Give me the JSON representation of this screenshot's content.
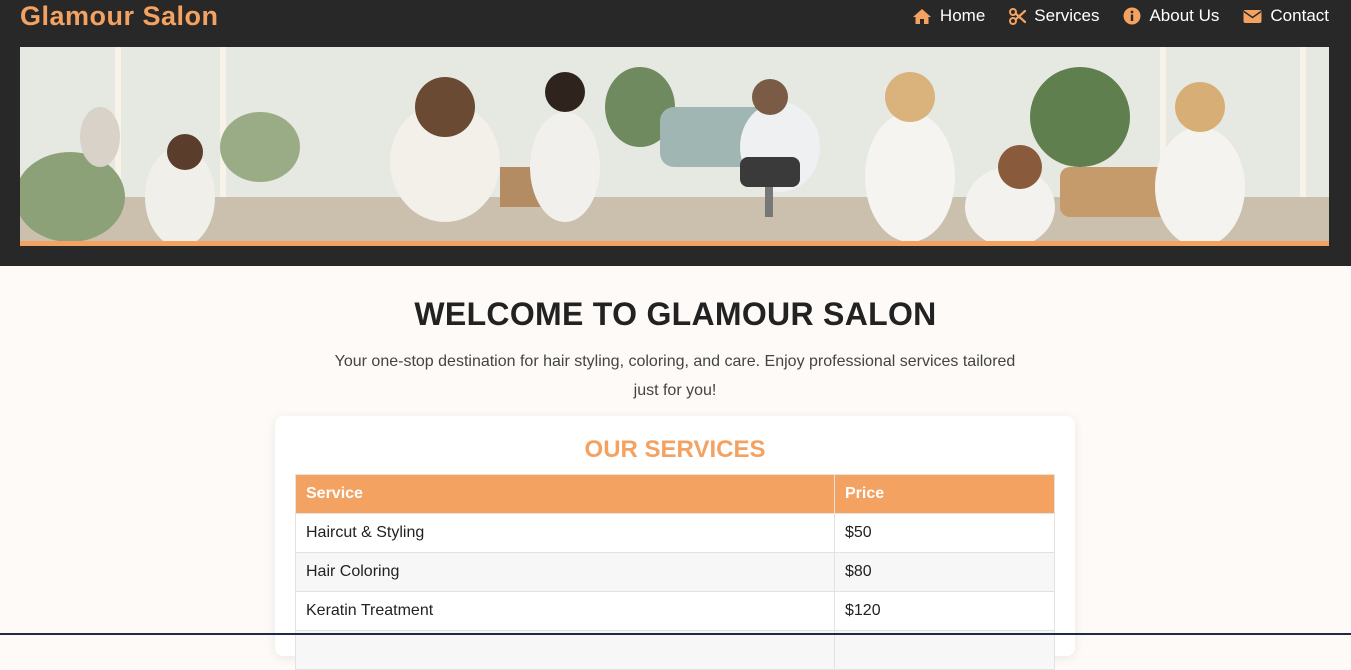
{
  "header": {
    "brand": "Glamour Salon",
    "nav": [
      {
        "label": "Home",
        "icon": "home-icon"
      },
      {
        "label": "Services",
        "icon": "scissors-icon"
      },
      {
        "label": "About Us",
        "icon": "info-icon"
      },
      {
        "label": "Contact",
        "icon": "envelope-icon"
      }
    ],
    "hero_image": "salon interior banner"
  },
  "welcome": {
    "title": "WELCOME TO GLAMOUR SALON",
    "text": "Your one-stop destination for hair styling, coloring, and care. Enjoy professional services tailored just for you!"
  },
  "services": {
    "title": "OUR SERVICES",
    "headers": [
      "Service",
      "Price"
    ],
    "rows": [
      [
        "Haircut & Styling",
        "$50"
      ],
      [
        "Hair Coloring",
        "$80"
      ],
      [
        "Keratin Treatment",
        "$120"
      ]
    ]
  },
  "colors": {
    "accent": "#f4a261",
    "header_bg": "#282828",
    "page_bg": "#fdfaf7"
  }
}
